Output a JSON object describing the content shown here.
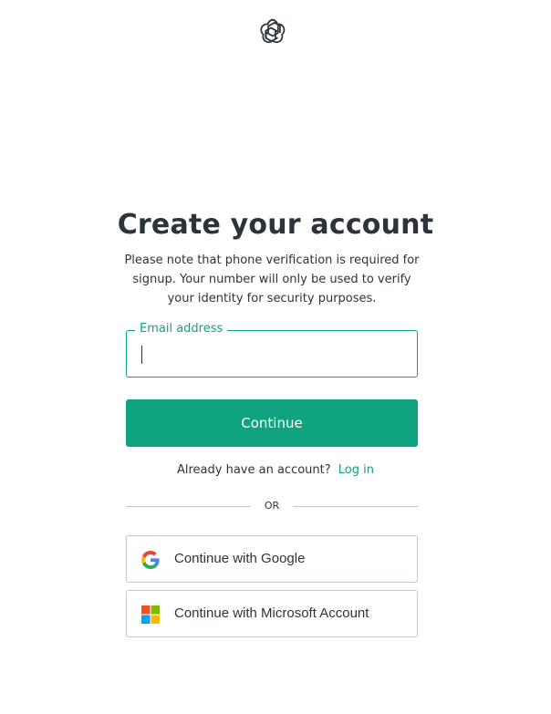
{
  "header": {
    "logo_icon": "openai-logo-icon"
  },
  "main": {
    "title": "Create your account",
    "subtitle": "Please note that phone verification is required for signup. Your number will only be used to verify your identity for security purposes.",
    "email_field": {
      "label": "Email address",
      "value": "",
      "placeholder": ""
    },
    "continue_label": "Continue",
    "login_prompt": "Already have an account?",
    "login_link": "Log in",
    "divider_text": "OR",
    "google_button": {
      "label": "Continue with Google",
      "icon": "google-icon"
    },
    "microsoft_button": {
      "label": "Continue with Microsoft Account",
      "icon": "microsoft-icon"
    }
  },
  "colors": {
    "accent": "#10a37f",
    "text": "#2d333a",
    "border": "#c2c8d0",
    "background": "#ffffff"
  }
}
